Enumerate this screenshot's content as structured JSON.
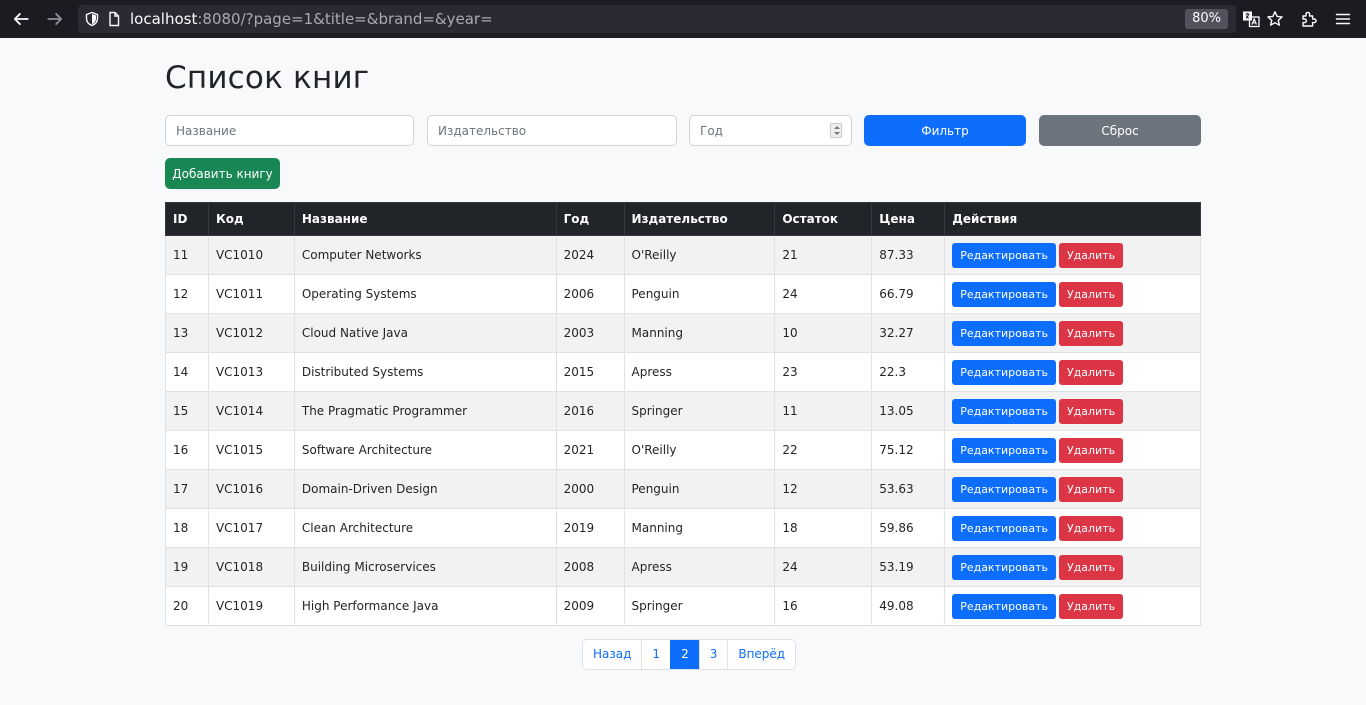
{
  "browser": {
    "url_host": "localhost",
    "url_rest": ":8080/?page=1&title=&brand=&year=",
    "zoom": "80%"
  },
  "page": {
    "title": "Список книг"
  },
  "filters": {
    "title_placeholder": "Название",
    "brand_placeholder": "Издательство",
    "year_placeholder": "Год",
    "filter_label": "Фильтр",
    "reset_label": "Сброс"
  },
  "add_label": "Добавить книгу",
  "table": {
    "headers": [
      "ID",
      "Код",
      "Название",
      "Год",
      "Издательство",
      "Остаток",
      "Цена",
      "Действия"
    ],
    "edit_label": "Редактировать",
    "delete_label": "Удалить",
    "rows": [
      [
        "11",
        "VC1010",
        "Computer Networks",
        "2024",
        "O'Reilly",
        "21",
        "87.33"
      ],
      [
        "12",
        "VC1011",
        "Operating Systems",
        "2006",
        "Penguin",
        "24",
        "66.79"
      ],
      [
        "13",
        "VC1012",
        "Cloud Native Java",
        "2003",
        "Manning",
        "10",
        "32.27"
      ],
      [
        "14",
        "VC1013",
        "Distributed Systems",
        "2015",
        "Apress",
        "23",
        "22.3"
      ],
      [
        "15",
        "VC1014",
        "The Pragmatic Programmer",
        "2016",
        "Springer",
        "11",
        "13.05"
      ],
      [
        "16",
        "VC1015",
        "Software Architecture",
        "2021",
        "O'Reilly",
        "22",
        "75.12"
      ],
      [
        "17",
        "VC1016",
        "Domain-Driven Design",
        "2000",
        "Penguin",
        "12",
        "53.63"
      ],
      [
        "18",
        "VC1017",
        "Clean Architecture",
        "2019",
        "Manning",
        "18",
        "59.86"
      ],
      [
        "19",
        "VC1018",
        "Building Microservices",
        "2008",
        "Apress",
        "24",
        "53.19"
      ],
      [
        "20",
        "VC1019",
        "High Performance Java",
        "2009",
        "Springer",
        "16",
        "49.08"
      ]
    ]
  },
  "pagination": {
    "prev": "Назад",
    "pages": [
      "1",
      "2",
      "3"
    ],
    "active": "2",
    "next": "Вперёд"
  }
}
